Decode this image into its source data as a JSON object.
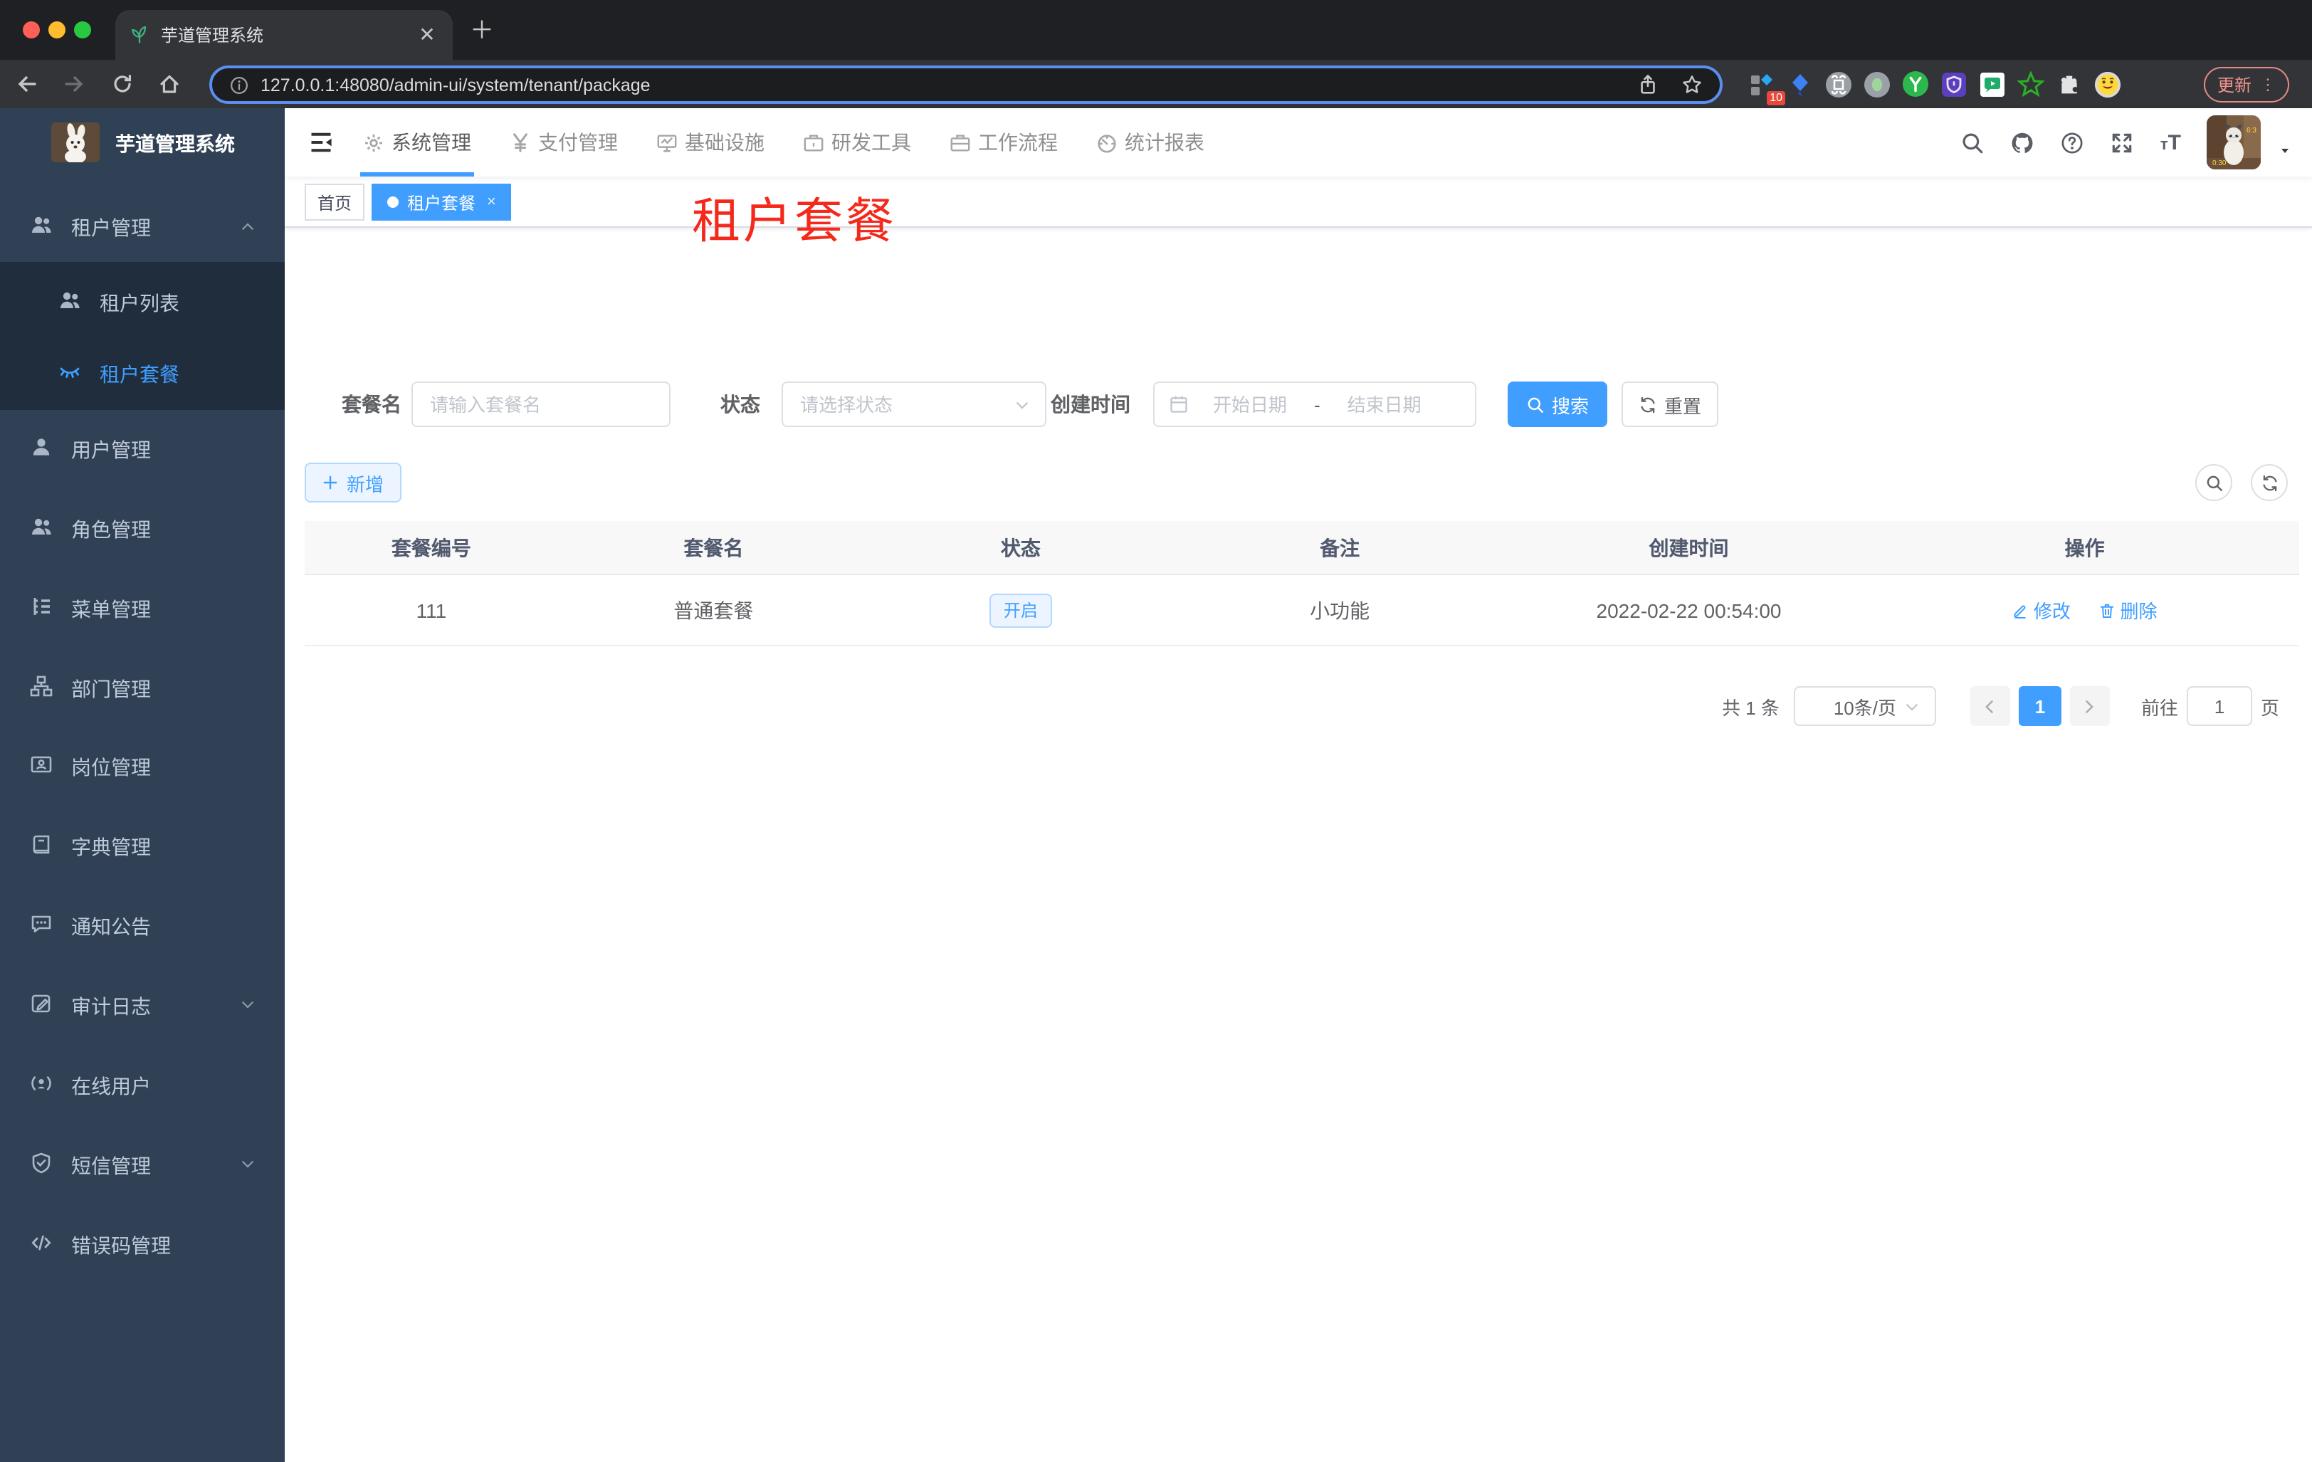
{
  "browser": {
    "tab_title": "芋道管理系统",
    "url": "127.0.0.1:48080/admin-ui/system/tenant/package",
    "update_label": "更新",
    "update_menu_dots": "⋮",
    "extension_badge": "10",
    "extensions": [
      "tag-grid-diamond",
      "blue-kite",
      "command-knot",
      "gray-record",
      "letter-y-green",
      "purple-shield",
      "green-chat",
      "green-star",
      "puzzle-extensions",
      "profile-emoji"
    ]
  },
  "app": {
    "logo_title": "芋道管理系统",
    "topnav": {
      "items": [
        {
          "label": "系统管理",
          "icon": "gear-icon",
          "active": true
        },
        {
          "label": "支付管理",
          "icon": "yen-icon",
          "active": false
        },
        {
          "label": "基础设施",
          "icon": "monitor-icon",
          "active": false
        },
        {
          "label": "研发工具",
          "icon": "toolbox-icon",
          "active": false
        },
        {
          "label": "工作流程",
          "icon": "briefcase-icon",
          "active": false
        },
        {
          "label": "统计报表",
          "icon": "dashboard-icon",
          "active": false
        }
      ]
    },
    "sidebar": {
      "items": [
        {
          "label": "租户管理",
          "icon": "peoples-icon",
          "level": 1,
          "expanded": true
        },
        {
          "label": "租户列表",
          "icon": "peoples-icon",
          "level": 2,
          "active": false
        },
        {
          "label": "租户套餐",
          "icon": "eye-closed-icon",
          "level": 2,
          "active": true
        },
        {
          "label": "用户管理",
          "icon": "user-icon",
          "level": 1
        },
        {
          "label": "角色管理",
          "icon": "peoples-icon",
          "level": 1
        },
        {
          "label": "菜单管理",
          "icon": "tree-table-icon",
          "level": 1
        },
        {
          "label": "部门管理",
          "icon": "org-tree-icon",
          "level": 1
        },
        {
          "label": "岗位管理",
          "icon": "post-badge-icon",
          "level": 1
        },
        {
          "label": "字典管理",
          "icon": "dict-book-icon",
          "level": 1
        },
        {
          "label": "通知公告",
          "icon": "message-icon",
          "level": 1
        },
        {
          "label": "审计日志",
          "icon": "log-edit-icon",
          "level": 1,
          "collapsed": true
        },
        {
          "label": "在线用户",
          "icon": "online-signal-icon",
          "level": 1
        },
        {
          "label": "短信管理",
          "icon": "shield-check-icon",
          "level": 1,
          "collapsed": true
        },
        {
          "label": "错误码管理",
          "icon": "code-icon",
          "level": 1
        }
      ]
    },
    "tags": {
      "home": "首页",
      "active": "租户套餐",
      "active_close": "×"
    },
    "watermark": "租户套餐",
    "filter": {
      "package_name_label": "套餐名",
      "package_name_placeholder": "请输入套餐名",
      "status_label": "状态",
      "status_placeholder": "请选择状态",
      "create_time_label": "创建时间",
      "start_placeholder": "开始日期",
      "range_separator": "-",
      "end_placeholder": "结束日期",
      "search_label": "搜索",
      "reset_label": "重置"
    },
    "toolbar": {
      "add_label": "新增"
    },
    "table": {
      "headers": [
        "套餐编号",
        "套餐名",
        "状态",
        "备注",
        "创建时间",
        "操作"
      ],
      "rows": [
        {
          "id": "111",
          "name": "普通套餐",
          "status": "开启",
          "remark": "小功能",
          "create_time": "2022-02-22 00:54:00",
          "edit_label": "修改",
          "delete_label": "删除"
        }
      ]
    },
    "pagination": {
      "total": "共 1 条",
      "page_size": "10条/页",
      "page": "1",
      "goto_label": "前往",
      "goto_value": "1",
      "goto_suffix": "页"
    }
  },
  "colors": {
    "primary": "#409eff",
    "sidebar_bg": "#304156",
    "submenu_bg": "#1f2d3d",
    "sidebar_text": "#bfcbd9",
    "watermark_red": "#f5291b",
    "status_tag_bg": "#ecf5ff",
    "status_tag_border": "#b3d8ff",
    "chrome_tabstrip": "#1f2023",
    "chrome_toolbar": "#333438",
    "urlbar_focus_ring": "#5a8ef0",
    "update_button": "#f0928c"
  }
}
